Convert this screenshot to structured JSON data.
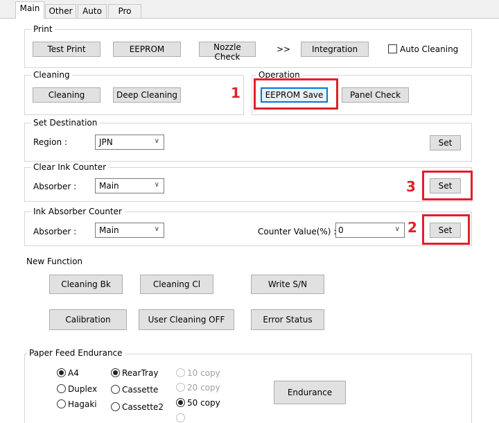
{
  "tabs": [
    "Main",
    "Other",
    "Auto",
    "Pro"
  ],
  "print": {
    "title": "Print",
    "test_print": "Test Print",
    "eeprom": "EEPROM",
    "nozzle_check": "Nozzle Check",
    "arrows": ">>",
    "integration": "Integration",
    "auto_cleaning": "Auto Cleaning"
  },
  "cleaning": {
    "title": "Cleaning",
    "cleaning": "Cleaning",
    "deep_cleaning": "Deep Cleaning"
  },
  "operation": {
    "title": "Operation",
    "eeprom_save": "EEPROM Save",
    "panel_check": "Panel Check"
  },
  "destination": {
    "title": "Set Destination",
    "region_label": "Region :",
    "region_value": "JPN",
    "set": "Set"
  },
  "clear_ink": {
    "title": "Clear Ink Counter",
    "absorber_label": "Absorber :",
    "absorber_value": "Main",
    "set": "Set"
  },
  "ink_absorber": {
    "title": "Ink Absorber Counter",
    "absorber_label": "Absorber :",
    "absorber_value": "Main",
    "counter_label": "Counter Value(%) :",
    "counter_value": "0",
    "set": "Set"
  },
  "new_function": {
    "title": "New Function",
    "cleaning_bk": "Cleaning Bk",
    "cleaning_cl": "Cleaning Cl",
    "write_sn": "Write S/N",
    "calibration": "Calibration",
    "user_cleaning_off": "User Cleaning OFF",
    "error_status": "Error Status"
  },
  "paper_feed": {
    "title": "Paper Feed Endurance",
    "size_options": [
      "A4",
      "Duplex",
      "Hagaki"
    ],
    "source_options": [
      "RearTray",
      "Cassette",
      "Cassette2"
    ],
    "copy_options": [
      "10 copy",
      "20 copy",
      "50 copy"
    ],
    "endurance": "Endurance"
  },
  "annotations": [
    "1",
    "2",
    "3"
  ],
  "colors": {
    "annotation_red": "#e0202a",
    "focus_blue": "#0078d7"
  }
}
